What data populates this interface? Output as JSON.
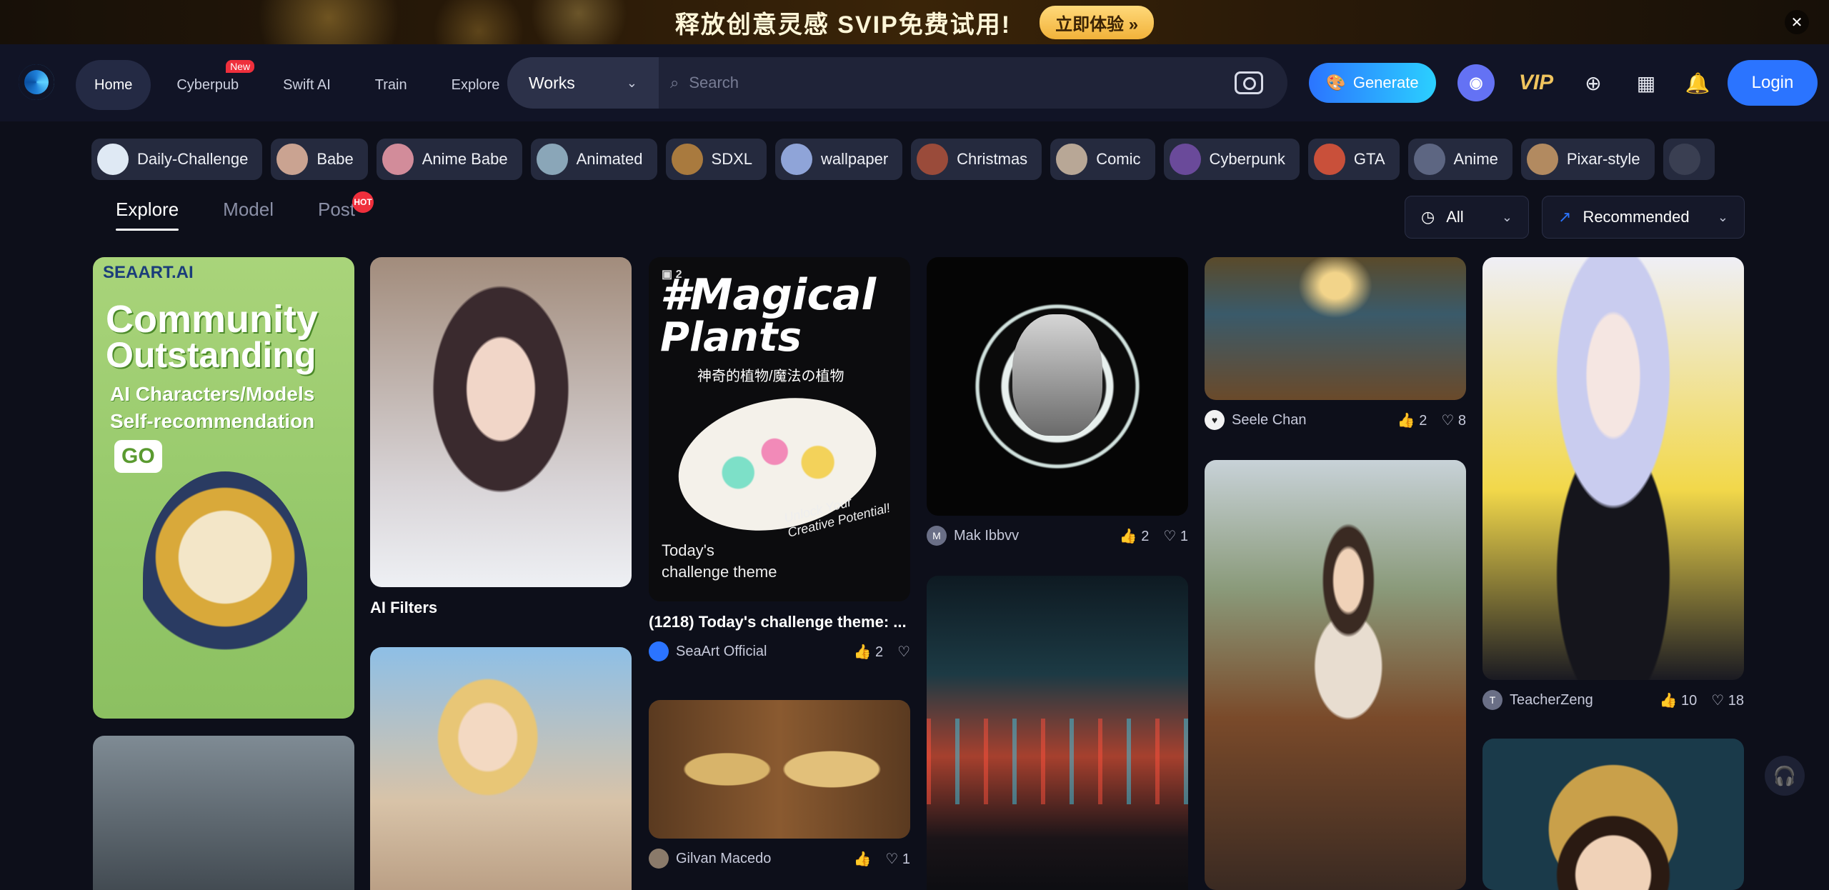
{
  "promo": {
    "text": "释放创意灵感  SVIP免费试用!",
    "cta": "立即体验 »",
    "close": "✕"
  },
  "nav": {
    "links": [
      {
        "label": "Home",
        "active": true
      },
      {
        "label": "Cyberpub",
        "badge": "New"
      },
      {
        "label": "Swift AI"
      },
      {
        "label": "Train"
      },
      {
        "label": "Explore"
      }
    ],
    "search": {
      "scope": "Works",
      "placeholder": "Search"
    },
    "generate": "Generate",
    "vip": "VIP",
    "login": "Login"
  },
  "tags": [
    {
      "label": "Daily-Challenge",
      "color": "#dfe9f4"
    },
    {
      "label": "Babe",
      "color": "#caa391"
    },
    {
      "label": "Anime Babe",
      "color": "#d28c9a"
    },
    {
      "label": "Animated",
      "color": "#8aa6b8"
    },
    {
      "label": "SDXL",
      "color": "#a97a3e"
    },
    {
      "label": "wallpaper",
      "color": "#8fa4d8"
    },
    {
      "label": "Christmas",
      "color": "#9a4b3a"
    },
    {
      "label": "Comic",
      "color": "#b8a796"
    },
    {
      "label": "Cyberpunk",
      "color": "#6a4a9a"
    },
    {
      "label": "GTA",
      "color": "#c9503a"
    },
    {
      "label": "Anime",
      "color": "#5d6682"
    },
    {
      "label": "Pixar-style",
      "color": "#b28a60"
    }
  ],
  "tabs": [
    {
      "label": "Explore",
      "active": true
    },
    {
      "label": "Model"
    },
    {
      "label": "Post",
      "badge": "HOT"
    }
  ],
  "filters": {
    "time": "All",
    "sort": "Recommended"
  },
  "cards": {
    "c1": {
      "brand": "SEAART.AI",
      "line1": "Community",
      "line2": "Outstanding",
      "line3": "AI Characters/Models",
      "line4": "Self-recommendation",
      "go": "GO"
    },
    "c2": {
      "title": "AI Filters"
    },
    "c3": {
      "count": "2",
      "head1": "#Magical",
      "head2": "Plants",
      "sub": "神奇的植物/魔法の植物",
      "theme1": "Today's",
      "theme2": "challenge theme",
      "script": "Unlock Your Creative Potential!",
      "title": "(1218) Today's challenge theme: ...",
      "user": "SeaArt Official",
      "likes": "2",
      "hearts": ""
    },
    "c4": {
      "user": "Mak Ibbvv",
      "initial": "M",
      "likes": "2",
      "hearts": "1"
    },
    "c5": {
      "user": "Seele Chan",
      "likes": "2",
      "hearts": "8"
    },
    "c6": {
      "user": "TeacherZeng",
      "initial": "T",
      "likes": "10",
      "hearts": "18"
    },
    "c7": {
      "user": "Gilvan Macedo",
      "likes": "",
      "hearts": "1"
    }
  },
  "colors": {
    "accent": "#2b74ff",
    "background": "#0d0f1a"
  }
}
